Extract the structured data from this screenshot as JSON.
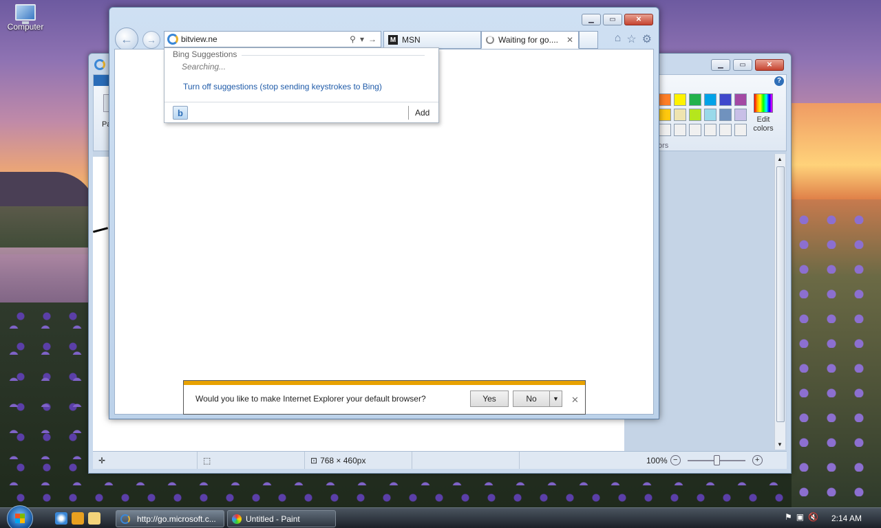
{
  "desktop": {
    "icons": [
      {
        "label": "Computer",
        "icon": "computer-icon"
      }
    ]
  },
  "paint": {
    "title": "Untitled - Paint",
    "ribbon_paste_label": "Pa",
    "colors_group_label": "ors",
    "edit_colors_line1": "Edit",
    "edit_colors_line2": "colors",
    "palette": [
      "#ff7f27",
      "#fff200",
      "#22b14c",
      "#00a2e8",
      "#3f48cc",
      "#a349a4",
      "#ffc90e",
      "#efe4b0",
      "#b5e61d",
      "#99d9ea",
      "#7092be",
      "#c8bfe7",
      "#f0f0f0",
      "#f0f0f0",
      "#f0f0f0",
      "#f0f0f0",
      "#f0f0f0",
      "#f0f0f0"
    ],
    "status": {
      "dimensions": "768 × 460px",
      "zoom": "100%",
      "zoom_level": 1.0
    }
  },
  "ie": {
    "address_value": "bitview.ne",
    "tabs": [
      {
        "label": "MSN",
        "icon": "msn-icon"
      },
      {
        "label": "Waiting for go....",
        "icon": "loading-spinner-icon",
        "active": true
      }
    ],
    "suggestions": {
      "header": "Bing Suggestions",
      "searching": "Searching...",
      "turn_off": "Turn off suggestions (stop sending keystrokes to Bing)",
      "add": "Add"
    },
    "notification": {
      "message": "Would you like to make Internet Explorer your default browser?",
      "yes": "Yes",
      "no": "No"
    },
    "accent_color": "#e8a200"
  },
  "taskbar": {
    "tasks": [
      {
        "label": "http://go.microsoft.c...",
        "icon": "ie-icon"
      },
      {
        "label": "Untitled - Paint",
        "icon": "paint-icon"
      }
    ],
    "clock": "2:14 AM"
  }
}
